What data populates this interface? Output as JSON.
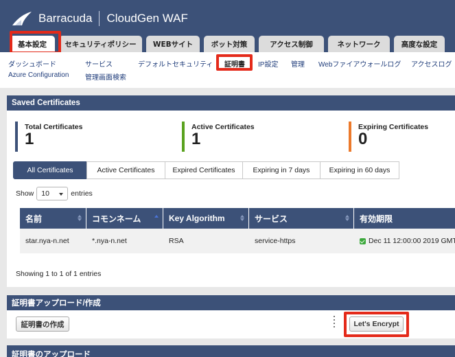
{
  "app": {
    "brand": "Barracuda",
    "product": "CloudGen WAF"
  },
  "tabs": [
    {
      "label": "基本設定",
      "active": true
    },
    {
      "label": "セキュリティポリシー"
    },
    {
      "label": "WEBサイト"
    },
    {
      "label": "ボット対策"
    },
    {
      "label": "アクセス制御"
    },
    {
      "label": "ネットワーク"
    },
    {
      "label": "高度な設定"
    }
  ],
  "subnav": [
    {
      "label": "ダッシュボード"
    },
    {
      "label": "サービス"
    },
    {
      "label": "デフォルトセキュリティ"
    },
    {
      "label": "証明書",
      "active": true
    },
    {
      "label": "IP設定"
    },
    {
      "label": "管理"
    },
    {
      "label": "Webファイアウォールログ"
    },
    {
      "label": "アクセスログ"
    },
    {
      "label": "Azure Configuration"
    },
    {
      "label": "管理画面検索"
    }
  ],
  "saved_certificates": {
    "title": "Saved Certificates",
    "stats": [
      {
        "label": "Total Certificates",
        "value": "1",
        "color": "#3c5178"
      },
      {
        "label": "Active Certificates",
        "value": "1",
        "color": "#5aa21f"
      },
      {
        "label": "Expiring Certificates",
        "value": "0",
        "color": "#ec7a2c"
      }
    ],
    "filters": [
      {
        "label": "All Certificates",
        "active": true
      },
      {
        "label": "Active Certificates"
      },
      {
        "label": "Expired Certificates"
      },
      {
        "label": "Expiring in 7 days"
      },
      {
        "label": "Expiring in 60 days"
      }
    ],
    "show_label": "Show",
    "entries_value": "10",
    "entries_label": "entries",
    "columns": [
      "名前",
      "コモンネーム",
      "Key Algorithm",
      "サービス",
      "有効期限"
    ],
    "rows": [
      {
        "name": "star.nya-n.net",
        "common_name": "*.nya-n.net",
        "algorithm": "RSA",
        "service": "service-https",
        "expiry": "Dec 11 12:00:00 2019 GMT"
      }
    ],
    "info": "Showing 1 to 1 of 1 entries"
  },
  "upload_create": {
    "title": "証明書アップロード/作成",
    "create_button": "証明書の作成",
    "letsencrypt_button": "Let's Encrypt"
  },
  "upload_section": {
    "title": "証明書のアップロード"
  },
  "colors": {
    "header": "#3c5178",
    "highlight": "#e42a1a"
  }
}
